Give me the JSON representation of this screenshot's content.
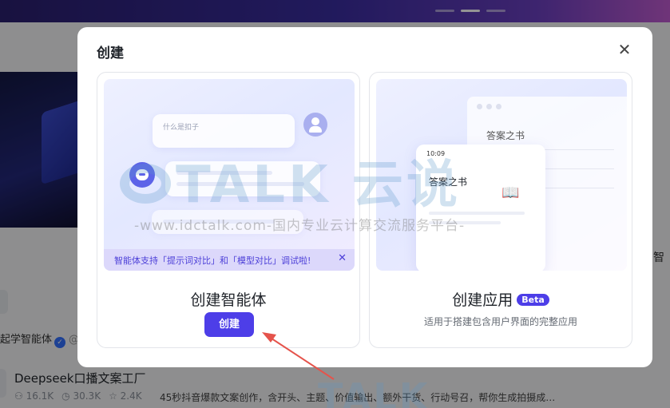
{
  "background": {
    "author_name": "起学智能体",
    "author_at": "@",
    "item_title": "Deepseek口播文案工厂",
    "item_stats": [
      "16.1K",
      "30.3K",
      "2.4K"
    ],
    "item_desc": "45秒抖音爆款文案创作，含开头、主题、价值输出、额外干货、行动号召，帮你生成拍摄成…",
    "right_edge_text": "智"
  },
  "modal": {
    "title": "创建",
    "close_icon": "close-icon",
    "agent_card": {
      "illustration": {
        "question_text": "什么是扣子",
        "notice_text": "智能体支持「提示词对比」和「模型对比」调试啦!",
        "notice_close": "✕"
      },
      "name": "创建智能体",
      "button_label": "创建"
    },
    "app_card": {
      "illustration": {
        "back_title": "答案之书",
        "phone_time": "10:09",
        "phone_title": "答案之书",
        "book_icon": "book-icon"
      },
      "name": "创建应用",
      "badge": "Beta",
      "description": "适用于搭建包含用户界面的完整应用"
    }
  },
  "watermark": {
    "logo": "TALK 云说",
    "url": "-www.idctalk.com-国内专业云计算交流服务平台-",
    "logo_bottom": "TALK"
  },
  "colors": {
    "primary": "#4d3ee8",
    "notice_bg": "#dcd8fb",
    "overlay": "rgba(0,0,0,0.42)"
  }
}
